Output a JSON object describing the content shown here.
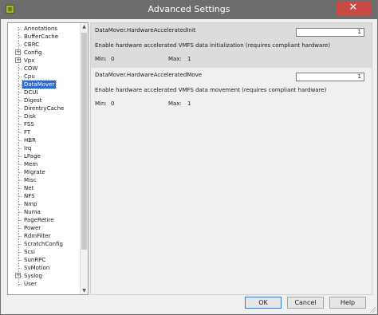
{
  "window": {
    "title": "Advanced Settings",
    "close_glyph": "✕",
    "icon": "vsphere-app-icon"
  },
  "tree": {
    "items": [
      {
        "label": "Annotations",
        "expandable": false,
        "selected": false
      },
      {
        "label": "BufferCache",
        "expandable": false,
        "selected": false
      },
      {
        "label": "CBRC",
        "expandable": false,
        "selected": false
      },
      {
        "label": "Config",
        "expandable": true,
        "selected": false
      },
      {
        "label": "Vpx",
        "expandable": true,
        "selected": false
      },
      {
        "label": "COW",
        "expandable": false,
        "selected": false
      },
      {
        "label": "Cpu",
        "expandable": false,
        "selected": false
      },
      {
        "label": "DataMover",
        "expandable": false,
        "selected": true
      },
      {
        "label": "DCUI",
        "expandable": false,
        "selected": false
      },
      {
        "label": "Digest",
        "expandable": false,
        "selected": false
      },
      {
        "label": "DirentryCache",
        "expandable": false,
        "selected": false
      },
      {
        "label": "Disk",
        "expandable": false,
        "selected": false
      },
      {
        "label": "FSS",
        "expandable": false,
        "selected": false
      },
      {
        "label": "FT",
        "expandable": false,
        "selected": false
      },
      {
        "label": "HBR",
        "expandable": false,
        "selected": false
      },
      {
        "label": "Irq",
        "expandable": false,
        "selected": false
      },
      {
        "label": "LPage",
        "expandable": false,
        "selected": false
      },
      {
        "label": "Mem",
        "expandable": false,
        "selected": false
      },
      {
        "label": "Migrate",
        "expandable": false,
        "selected": false
      },
      {
        "label": "Misc",
        "expandable": false,
        "selected": false
      },
      {
        "label": "Net",
        "expandable": false,
        "selected": false
      },
      {
        "label": "NFS",
        "expandable": false,
        "selected": false
      },
      {
        "label": "Nmp",
        "expandable": false,
        "selected": false
      },
      {
        "label": "Numa",
        "expandable": false,
        "selected": false
      },
      {
        "label": "PageRetire",
        "expandable": false,
        "selected": false
      },
      {
        "label": "Power",
        "expandable": false,
        "selected": false
      },
      {
        "label": "RdmFilter",
        "expandable": false,
        "selected": false
      },
      {
        "label": "ScratchConfig",
        "expandable": false,
        "selected": false
      },
      {
        "label": "Scsi",
        "expandable": false,
        "selected": false
      },
      {
        "label": "SunRPC",
        "expandable": false,
        "selected": false
      },
      {
        "label": "SvMotion",
        "expandable": false,
        "selected": false
      },
      {
        "label": "Syslog",
        "expandable": true,
        "selected": false
      },
      {
        "label": "User",
        "expandable": false,
        "selected": false
      }
    ],
    "expander_glyph": "+",
    "scroll_up_glyph": "▲",
    "scroll_down_glyph": "▼"
  },
  "settings": [
    {
      "name": "DataMover.HardwareAcceleratedInit",
      "value": "1",
      "description": "Enable hardware accelerated VMFS data initialization (requires compliant hardware)",
      "min_label": "Min:",
      "min": "0",
      "max_label": "Max:",
      "max": "1"
    },
    {
      "name": "DataMover.HardwareAcceleratedMove",
      "value": "1",
      "description": "Enable hardware accelerated VMFS data movement (requires compliant hardware)",
      "min_label": "Min:",
      "min": "0",
      "max_label": "Max:",
      "max": "1"
    }
  ],
  "buttons": {
    "ok": "OK",
    "cancel": "Cancel",
    "help": "Help"
  }
}
